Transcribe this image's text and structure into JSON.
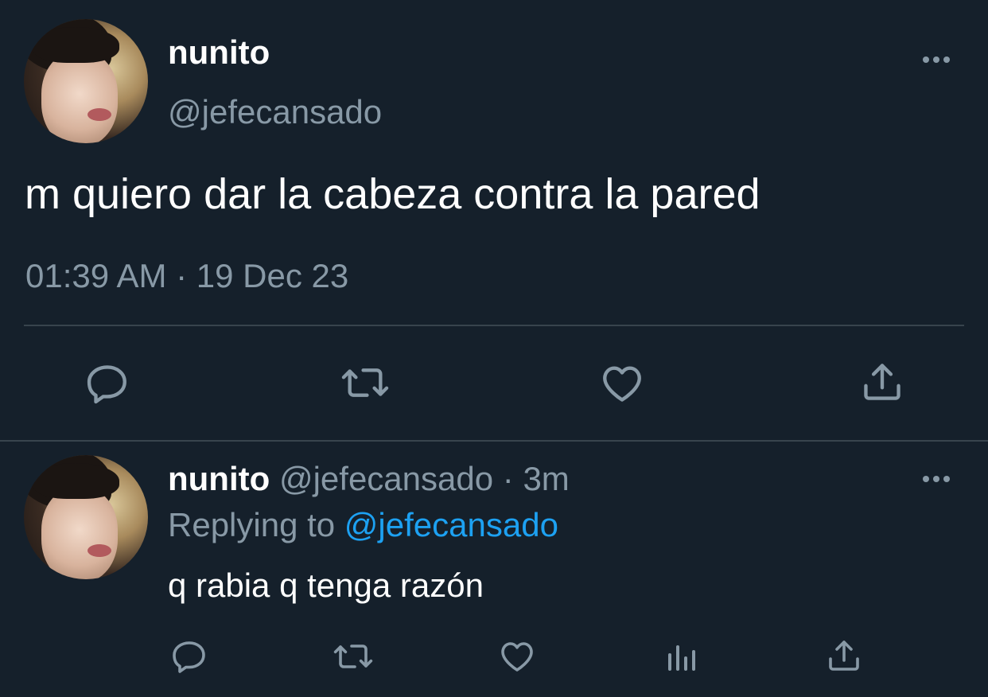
{
  "main_tweet": {
    "display_name": "nunito",
    "handle": "@jefecansado",
    "text": "m quiero dar la cabeza contra la pared",
    "timestamp": "01:39 AM · 19 Dec 23",
    "actions": [
      "reply-icon",
      "retweet-icon",
      "like-icon",
      "share-icon"
    ]
  },
  "reply_tweet": {
    "display_name": "nunito",
    "handle": "@jefecansado",
    "separator": "·",
    "age": "3m",
    "replying_prefix": "Replying to",
    "replying_to": "@jefecansado",
    "text": "q rabia q tenga razón",
    "actions": [
      "reply-icon",
      "retweet-icon",
      "like-icon",
      "analytics-icon",
      "share-icon"
    ]
  },
  "colors": {
    "background": "#15202b",
    "text": "#ffffff",
    "muted": "#8899a6",
    "link": "#1da1f2",
    "divider": "#38444d"
  }
}
